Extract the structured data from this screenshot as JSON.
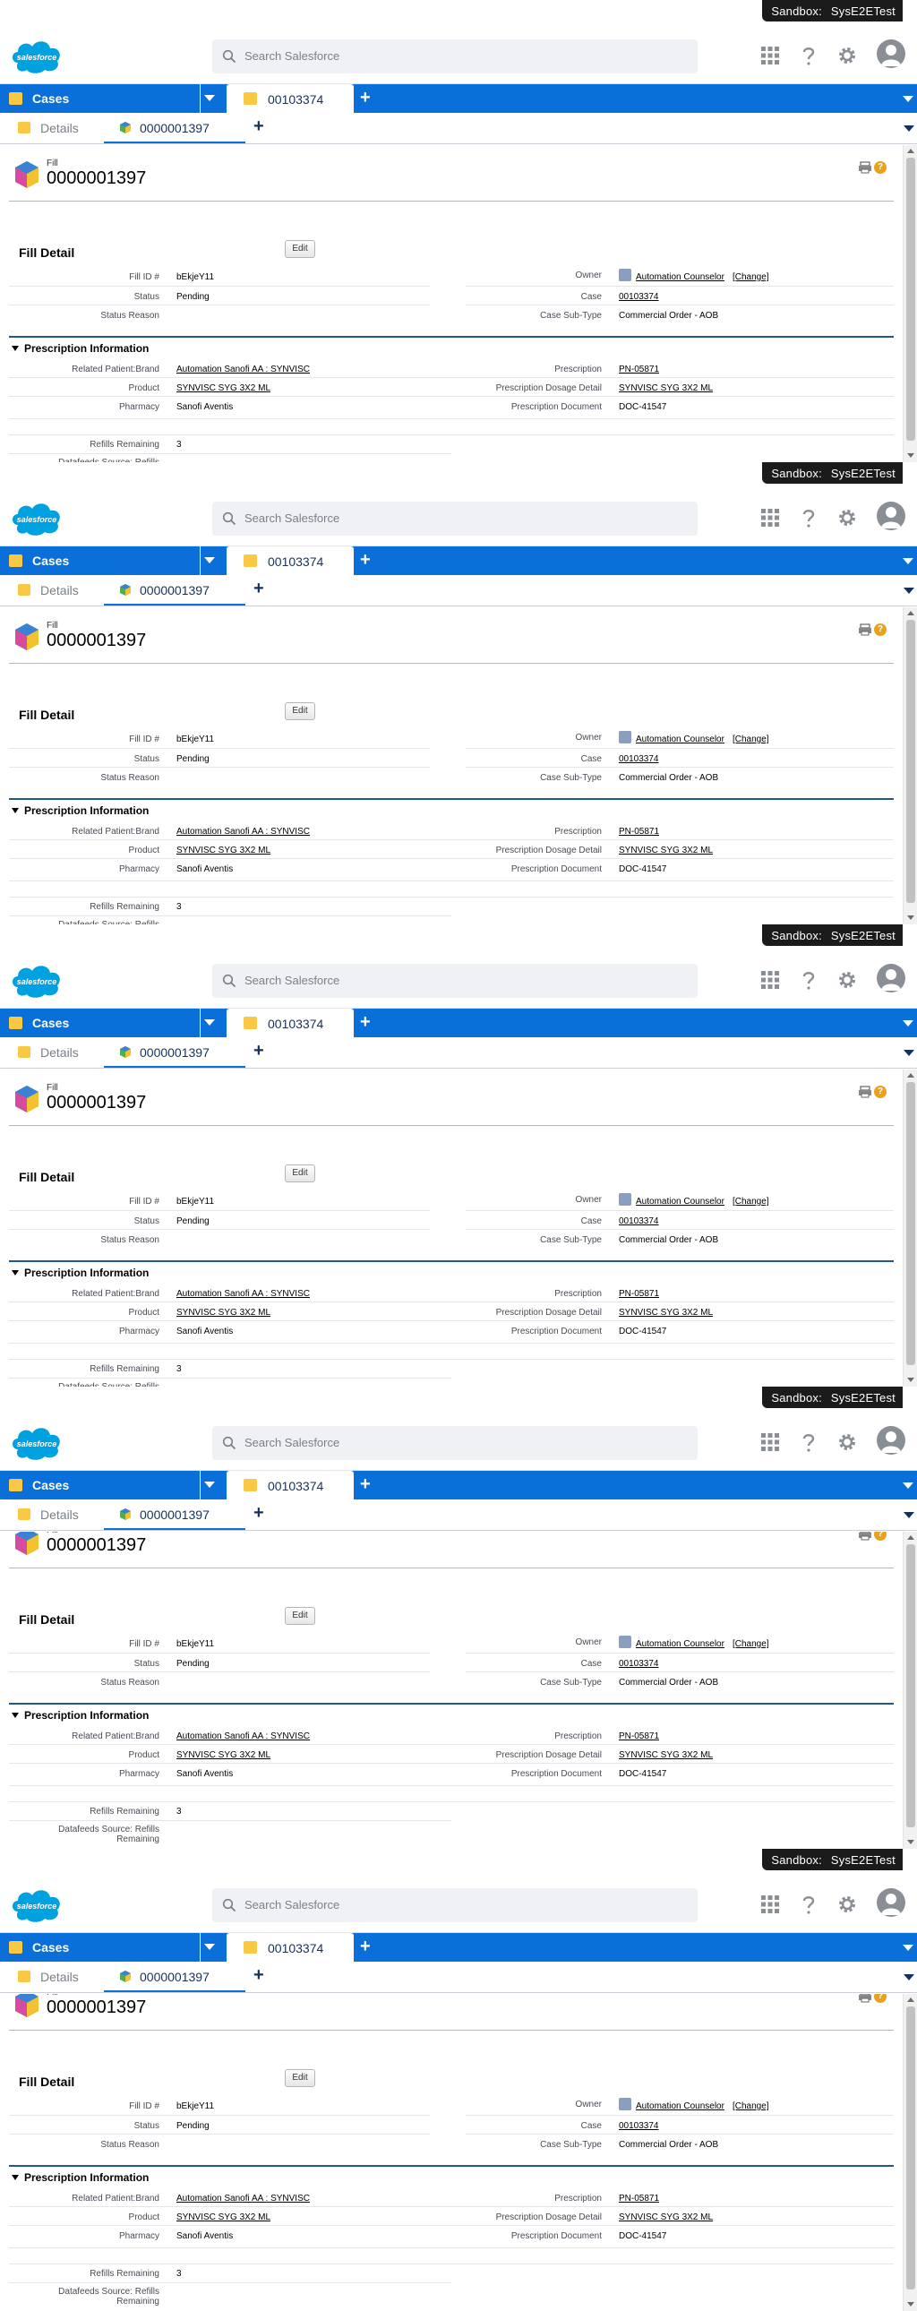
{
  "sandbox": {
    "label": "Sandbox:",
    "name": "SysE2ETest"
  },
  "logo_text": "salesforce",
  "search": {
    "placeholder": "Search Salesforce"
  },
  "header_icons": [
    "app-launcher-icon",
    "help-icon",
    "setup-gear-icon",
    "user-avatar-icon"
  ],
  "navbar": {
    "app_tab": "Cases",
    "record_tab": "00103374"
  },
  "subtabs": {
    "details": "Details",
    "fill": "0000001397"
  },
  "record": {
    "type": "Fill",
    "name": "0000001397",
    "help_glyph": "?"
  },
  "fill_detail": {
    "title": "Fill Detail",
    "edit_label": "Edit",
    "left": [
      {
        "label": "Fill ID #",
        "value": "bEkjeY11"
      },
      {
        "label": "Status",
        "value": "Pending"
      },
      {
        "label": "Status Reason",
        "value": ""
      }
    ],
    "right": [
      {
        "label": "Owner",
        "value": "Automation Counselor",
        "extra": "[Change]"
      },
      {
        "label": "Case",
        "value": "00103374"
      },
      {
        "label": "Case Sub-Type",
        "value": "Commercial Order - AOB"
      }
    ]
  },
  "prescription": {
    "title": "Prescription Information",
    "left": [
      {
        "label": "Related Patient:Brand",
        "value": "Automation Sanofi AA : SYNVISC"
      },
      {
        "label": "Product",
        "value": "SYNVISC SYG 3X2 ML"
      },
      {
        "label": "Pharmacy",
        "value": "Sanofi Aventis"
      }
    ],
    "right": [
      {
        "label": "Prescription",
        "value": "PN-05871"
      },
      {
        "label": "Prescription Dosage Detail",
        "value": "SYNVISC SYG 3X2 ML"
      },
      {
        "label": "Prescription Document",
        "value": "DOC-41547"
      }
    ],
    "refills_label": "Refills Remaining",
    "refills_value": "3",
    "datafeeds_label_1": "Datafeeds Source: Refills",
    "datafeeds_label_2": "Remaining"
  },
  "colors": {
    "nav_blue": "#0a6fd8",
    "section_rule": "#1f5a8f",
    "tab_yellow": "#f9c844"
  },
  "frame_scroll_offsets": [
    0,
    0,
    0,
    22,
    22
  ]
}
